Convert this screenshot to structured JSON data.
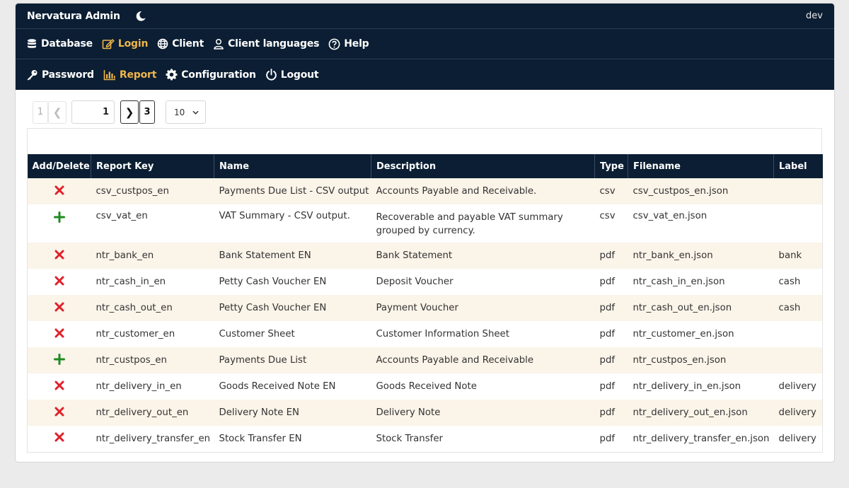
{
  "app": {
    "title": "Nervatura Admin",
    "env": "dev",
    "theme_icon": "moon-icon"
  },
  "nav_row1": [
    {
      "label": "Database",
      "icon": "database-icon",
      "active": false
    },
    {
      "label": "Login",
      "icon": "edit-icon",
      "active": true
    },
    {
      "label": "Client",
      "icon": "globe-icon",
      "active": false
    },
    {
      "label": "Client languages",
      "icon": "user-icon",
      "active": false
    },
    {
      "label": "Help",
      "icon": "question-icon",
      "active": false
    }
  ],
  "nav_row2": [
    {
      "label": "Password",
      "icon": "key-icon",
      "active": false
    },
    {
      "label": "Report",
      "icon": "chart-icon",
      "active": true
    },
    {
      "label": "Configuration",
      "icon": "gear-icon",
      "active": false
    },
    {
      "label": "Logout",
      "icon": "power-icon",
      "active": false
    }
  ],
  "pagination": {
    "first_page": "1",
    "prev_symbol": "❮",
    "current": "1",
    "next_symbol": "❯",
    "last_page": "3",
    "page_size": "10"
  },
  "table": {
    "headers": [
      "Add/Delete",
      "Report Key",
      "Name",
      "Description",
      "Type",
      "Filename",
      "Label"
    ],
    "rows": [
      {
        "action": "delete",
        "key": "csv_custpos_en",
        "name": "Payments Due List - CSV output",
        "description": "Accounts Payable and Receivable.",
        "type": "csv",
        "filename": "csv_custpos_en.json",
        "label": ""
      },
      {
        "action": "add",
        "key": "csv_vat_en",
        "name": "VAT Summary - CSV output.",
        "description": "Recoverable and payable VAT summary grouped by currency.",
        "type": "csv",
        "filename": "csv_vat_en.json",
        "label": ""
      },
      {
        "action": "delete",
        "key": "ntr_bank_en",
        "name": "Bank Statement EN",
        "description": "Bank Statement",
        "type": "pdf",
        "filename": "ntr_bank_en.json",
        "label": "bank"
      },
      {
        "action": "delete",
        "key": "ntr_cash_in_en",
        "name": "Petty Cash Voucher EN",
        "description": "Deposit Voucher",
        "type": "pdf",
        "filename": "ntr_cash_in_en.json",
        "label": "cash"
      },
      {
        "action": "delete",
        "key": "ntr_cash_out_en",
        "name": "Petty Cash Voucher EN",
        "description": "Payment Voucher",
        "type": "pdf",
        "filename": "ntr_cash_out_en.json",
        "label": "cash"
      },
      {
        "action": "delete",
        "key": "ntr_customer_en",
        "name": "Customer Sheet",
        "description": "Customer Information Sheet",
        "type": "pdf",
        "filename": "ntr_customer_en.json",
        "label": ""
      },
      {
        "action": "add",
        "key": "ntr_custpos_en",
        "name": "Payments Due List",
        "description": "Accounts Payable and Receivable",
        "type": "pdf",
        "filename": "ntr_custpos_en.json",
        "label": ""
      },
      {
        "action": "delete",
        "key": "ntr_delivery_in_en",
        "name": "Goods Received Note EN",
        "description": "Goods Received Note",
        "type": "pdf",
        "filename": "ntr_delivery_in_en.json",
        "label": "delivery"
      },
      {
        "action": "delete",
        "key": "ntr_delivery_out_en",
        "name": "Delivery Note EN",
        "description": "Delivery Note",
        "type": "pdf",
        "filename": "ntr_delivery_out_en.json",
        "label": "delivery"
      },
      {
        "action": "delete",
        "key": "ntr_delivery_transfer_en",
        "name": "Stock Transfer EN",
        "description": "Stock Transfer",
        "type": "pdf",
        "filename": "ntr_delivery_transfer_en.json",
        "label": "delivery"
      }
    ]
  },
  "colors": {
    "navbar": "#0b1e33",
    "active": "#f0b64a",
    "delete": "#e0202a",
    "add": "#1f8a1f",
    "row_alt": "#fbf4e9"
  }
}
